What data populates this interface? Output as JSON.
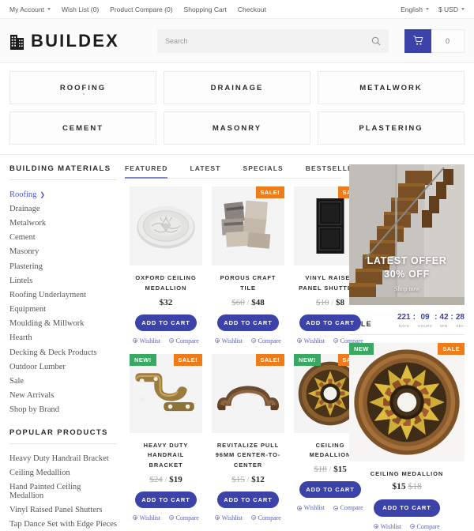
{
  "topbar": {
    "left_items": [
      {
        "label": "My Account",
        "caret": true
      },
      {
        "label": "Wish List (0)",
        "caret": false
      },
      {
        "label": "Product Compare (0)",
        "caret": false
      },
      {
        "label": "Shopping Cart",
        "caret": false
      },
      {
        "label": "Checkout",
        "caret": false
      }
    ],
    "language": "English",
    "currency": "$ USD"
  },
  "header": {
    "brand": "BUILDEX",
    "search_placeholder": "Search",
    "cart_count": "0"
  },
  "categories": [
    {
      "label": "ROOFING",
      "active": true
    },
    {
      "label": "DRAINAGE",
      "active": false
    },
    {
      "label": "METALWORK",
      "active": false
    },
    {
      "label": "CEMENT",
      "active": false
    },
    {
      "label": "MASONRY",
      "active": false
    },
    {
      "label": "PLASTERING",
      "active": false
    }
  ],
  "sidebar": {
    "materials_title": "BUILDING MATERIALS",
    "materials": [
      {
        "label": "Roofing",
        "active": true
      },
      {
        "label": "Drainage",
        "active": false
      },
      {
        "label": "Metalwork",
        "active": false
      },
      {
        "label": "Cement",
        "active": false
      },
      {
        "label": "Masonry",
        "active": false
      },
      {
        "label": "Plastering",
        "active": false
      },
      {
        "label": "Lintels",
        "active": false
      },
      {
        "label": "Roofing Underlayment",
        "active": false
      },
      {
        "label": "Equipment",
        "active": false
      },
      {
        "label": "Moulding & Millwork",
        "active": false
      },
      {
        "label": "Hearth",
        "active": false
      },
      {
        "label": "Decking & Deck Products",
        "active": false
      },
      {
        "label": "Outdoor Lumber",
        "active": false
      },
      {
        "label": "Sale",
        "active": false
      },
      {
        "label": "New Arrivals",
        "active": false
      },
      {
        "label": "Shop by Brand",
        "active": false
      }
    ],
    "popular_title": "POPULAR PRODUCTS",
    "popular": [
      {
        "label": "Heavy Duty Handrail Bracket"
      },
      {
        "label": "Ceiling Medallion"
      },
      {
        "label": "Hand Painted Ceiling Medallion"
      },
      {
        "label": "Vinyl Raised Panel Shutters"
      },
      {
        "label": "Tap Dance Set with Edge Pieces"
      }
    ]
  },
  "tabs": [
    {
      "label": "FEATURED",
      "active": true
    },
    {
      "label": "LATEST",
      "active": false
    },
    {
      "label": "SPECIALS",
      "active": false
    },
    {
      "label": "BESTSELLERS",
      "active": false
    }
  ],
  "products": [
    {
      "title": "OXFORD CEILING MEDALLION",
      "old_price": "",
      "new_price": "$32",
      "badge_new": "",
      "badge_sale": "",
      "cart_label": "ADD TO CART",
      "wishlist_label": "Wishlist",
      "compare_label": "Compare",
      "image": "oxford-ceiling-medallion"
    },
    {
      "title": "POROUS CRAFT TILE",
      "old_price": "$60",
      "new_price": "$48",
      "badge_new": "",
      "badge_sale": "SALE!",
      "cart_label": "ADD TO CART",
      "wishlist_label": "Wishlist",
      "compare_label": "Compare",
      "image": "porous-craft-tile"
    },
    {
      "title": "VINYL RAISED PANEL SHUTTERS",
      "old_price": "$10",
      "new_price": "$8",
      "badge_new": "",
      "badge_sale": "SALE!",
      "cart_label": "ADD TO CART",
      "wishlist_label": "Wishlist",
      "compare_label": "Compare",
      "image": "vinyl-raised-panel-shutters"
    },
    {
      "title": "HEAVY DUTY HANDRAIL BRACKET",
      "old_price": "$24",
      "new_price": "$19",
      "badge_new": "NEW!",
      "badge_sale": "SALE!",
      "cart_label": "ADD TO CART",
      "wishlist_label": "Wishlist",
      "compare_label": "Compare",
      "image": "heavy-duty-handrail-bracket"
    },
    {
      "title": "REVITALIZE PULL 96MM CENTER-TO-CENTER",
      "old_price": "$15",
      "new_price": "$12",
      "badge_new": "",
      "badge_sale": "SALE!",
      "cart_label": "ADD TO CART",
      "wishlist_label": "Wishlist",
      "compare_label": "Compare",
      "image": "revitalize-pull"
    },
    {
      "title": "CEILING MEDALLION",
      "old_price": "$18",
      "new_price": "$15",
      "badge_new": "NEW!",
      "badge_sale": "SALE!",
      "cart_label": "ADD TO CART",
      "wishlist_label": "Wishlist",
      "compare_label": "Compare",
      "image": "ceiling-medallion"
    }
  ],
  "offer_banner": {
    "line1": "LATEST OFFER",
    "line2": "30% OFF",
    "cta": "Shop now",
    "image": "wooden-staircase"
  },
  "sale_block": {
    "label": "SALE",
    "timer": [
      {
        "value": "221",
        "unit": "DAYS"
      },
      {
        "value": "09",
        "unit": "HOURS"
      },
      {
        "value": "42",
        "unit": "MIN"
      },
      {
        "value": "28",
        "unit": "SEC"
      }
    ],
    "product": {
      "badge_new": "NEW",
      "badge_sale": "SALE",
      "title": "CEILING MEDALLION",
      "new_price": "$15",
      "old_price": "$18",
      "cart_label": "ADD TO CART",
      "wishlist_label": "Wishlist",
      "compare_label": "Compare",
      "image": "ceiling-medallion-large"
    }
  },
  "colors": {
    "accent_blue": "#3b42a8",
    "badge_sale": "#ef7c1b",
    "badge_new": "#3aa863",
    "link_blue": "#5b61b5"
  }
}
